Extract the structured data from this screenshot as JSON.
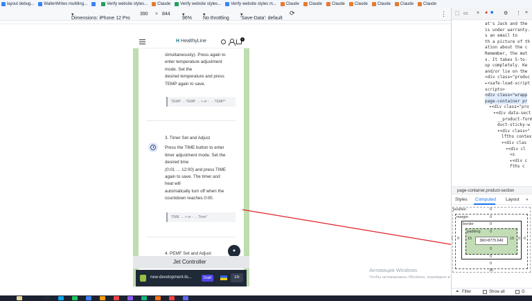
{
  "bookmarks": [
    {
      "label": "layout debug...",
      "favicon": "blue-icon"
    },
    {
      "label": "WalterWrites multiling...",
      "favicon": "blue-icon"
    },
    {
      "label": "",
      "favicon": "blue-icon"
    },
    {
      "label": "Verify website styles...",
      "favicon": "green-icon"
    },
    {
      "label": "Claude",
      "favicon": "orange-icon"
    },
    {
      "label": "Verify website styles...",
      "favicon": "green-icon"
    },
    {
      "label": "Verify website styles m...",
      "favicon": "blue-icon"
    },
    {
      "label": "Claude",
      "favicon": "orange-icon"
    },
    {
      "label": "Claude",
      "favicon": "orange-icon"
    },
    {
      "label": "Claude",
      "favicon": "orange-icon"
    },
    {
      "label": "Claude",
      "favicon": "orange-icon"
    },
    {
      "label": "Claude",
      "favicon": "orange-icon"
    },
    {
      "label": "Claude",
      "favicon": "orange-icon"
    },
    {
      "label": "Claude",
      "favicon": "orange-icon"
    }
  ],
  "device_toolbar": {
    "dimensions_label": "Dimensions: iPhone 12 Pro",
    "width": "390",
    "times": "×",
    "height": "844",
    "zoom": "96%",
    "throttle": "No throttling",
    "save_data": "'Save-Data': default"
  },
  "phone": {
    "logo_mark": "H",
    "logo_text": "HealthyLine",
    "cart_count": "1",
    "lines_a": [
      "simultaneously). Press again to",
      "enter temperature adjustment",
      "mode. Set the",
      "desired temperature and press",
      "TEMP again to save."
    ],
    "code_temp": "TEMP → TEMP → + or - → TEMP*",
    "step3_title": "3. Timer Set and Adjust",
    "lines_b": [
      "Press the TIME button to enter",
      "timer adjustment mode. Set the",
      "desired time",
      "(0:01 … 12:00) and press TIME",
      "again to save. The timer and",
      "heat will",
      "automatically turn off when the",
      "countdown reaches 0:00."
    ],
    "code_time": "TIME → + or - → Time*",
    "step4_title": "4. PEMF Set and Adjust",
    "jet_label": "Jet Controller",
    "chat_icon": "chat-icon"
  },
  "preview_bar": {
    "store_name": "new-development-lis...",
    "draft": "Draft",
    "lang": "EN"
  },
  "watermark": {
    "title": "Активация Windows",
    "subtitle": "Чтобы активировать Windows, перейдите в раздел \"Параметры\"."
  },
  "devtools": {
    "elements": [
      {
        "text": "at's Jack and the",
        "indent": 0
      },
      {
        "text": "is under warranty.",
        "indent": 0
      },
      {
        "text": "s an email to",
        "indent": 0
      },
      {
        "text": "th a picture of th",
        "indent": 0
      },
      {
        "text": "ation about the c",
        "indent": 0
      },
      {
        "text": "Remember, the mat",
        "indent": 0
      },
      {
        "text": "s. It takes 5-to-",
        "indent": 0
      },
      {
        "text": "up completely. Ke",
        "indent": 0
      },
      {
        "text": "and/or lie on the",
        "indent": 0
      },
      {
        "text": "<div class=\"produc",
        "indent": 0
      },
      {
        "text": "▸<safe-load-script",
        "indent": 0
      },
      {
        "text": "scripts>",
        "indent": 0
      },
      {
        "text": "<div class=\"wrapp",
        "indent": 0
      },
      {
        "text": "page-container pr",
        "indent": 0
      },
      {
        "text": "▾<div class=\"pro",
        "indent": 1
      },
      {
        "text": "▾<div data-sect",
        "indent": 2
      },
      {
        "text": "__product-form",
        "indent": 3
      },
      {
        "text": "duct-sticky-w",
        "indent": 3
      },
      {
        "text": "▾<div class=\"",
        "indent": 3
      },
      {
        "text": "lfths contex",
        "indent": 4
      },
      {
        "text": "▾<div clas",
        "indent": 4
      },
      {
        "text": "▾<div cl",
        "indent": 5
      },
      {
        "text": "<s",
        "indent": 6
      },
      {
        "text": "▸<div c",
        "indent": 6
      },
      {
        "text": "fths c",
        "indent": 6
      }
    ],
    "breadcrumb": "page-container.product-section",
    "tabs": [
      "Styles",
      "Computed",
      "Layout"
    ],
    "box_model": {
      "position_label": "position",
      "position_val": "0",
      "margin_label": "margin",
      "margin_top": "0",
      "margin_bottom": "0",
      "margin_left": "0",
      "margin_right": "0",
      "border_label": "border",
      "border_top": "0",
      "border_bottom": "0",
      "border_left": "0",
      "border_right": "0",
      "padding_label": "padding",
      "padding_top": "0",
      "padding_bottom": "0",
      "padding_left": "15",
      "padding_right": "15",
      "content": "360×8775.640",
      "bottom_val": "30"
    },
    "filter_label": "Filter",
    "show_all_label": "Show all"
  },
  "colors": {
    "accent": "#1a73e8",
    "padding_green": "#c2ddb6",
    "page_green": "#bfddb0",
    "arrow_red": "#e02020"
  }
}
